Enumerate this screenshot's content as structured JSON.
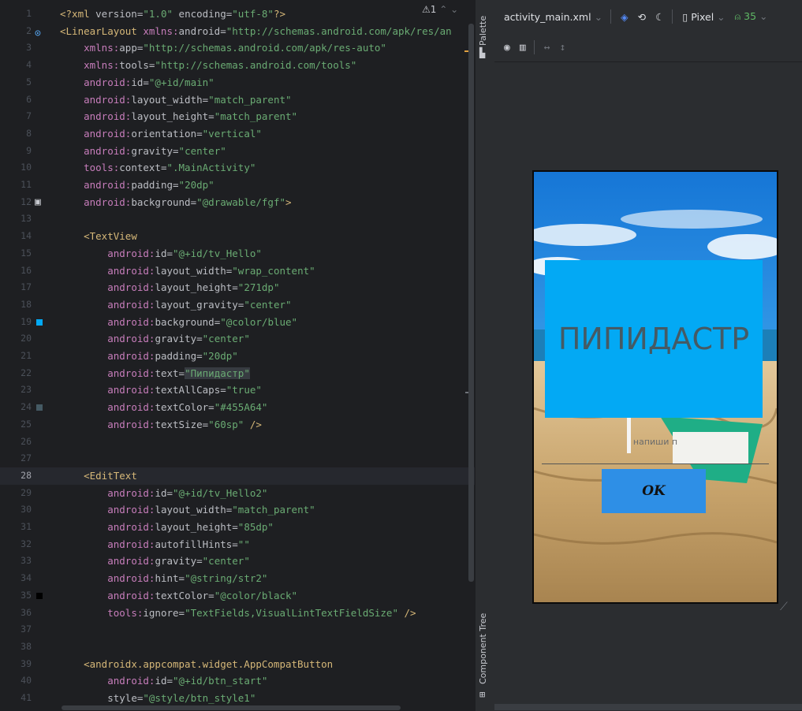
{
  "editor": {
    "warning_count": "1",
    "lines": [
      {
        "n": "1",
        "html": "<span class='t'>&lt;?xml </span><span class='a'>version=</span><span class='s'>\"1.0\"</span><span class='a'> encoding=</span><span class='s'>\"utf-8\"</span><span class='t'>?&gt;</span>"
      },
      {
        "n": "2",
        "html": "<span class='t'>&lt;LinearLayout </span><span class='ns'>xmlns:</span><span class='a'>android=</span><span class='s'>\"http://schemas.android.com/apk/res/an</span>"
      },
      {
        "n": "3",
        "html": "    <span class='ns'>xmlns:</span><span class='a'>app=</span><span class='s'>\"http://schemas.android.com/apk/res-auto\"</span>"
      },
      {
        "n": "4",
        "html": "    <span class='ns'>xmlns:</span><span class='a'>tools=</span><span class='s'>\"http://schemas.android.com/tools\"</span>"
      },
      {
        "n": "5",
        "html": "    <span class='ns'>android:</span><span class='a'>id=</span><span class='s'>\"@+id/main\"</span>"
      },
      {
        "n": "6",
        "html": "    <span class='ns'>android:</span><span class='a'>layout_width=</span><span class='s'>\"match_parent\"</span>"
      },
      {
        "n": "7",
        "html": "    <span class='ns'>android:</span><span class='a'>layout_height=</span><span class='s'>\"match_parent\"</span>"
      },
      {
        "n": "8",
        "html": "    <span class='ns'>android:</span><span class='a'>orientation=</span><span class='s'>\"vertical\"</span>"
      },
      {
        "n": "9",
        "html": "    <span class='ns'>android:</span><span class='a'>gravity=</span><span class='s'>\"center\"</span>"
      },
      {
        "n": "10",
        "html": "    <span class='ns'>tools:</span><span class='a'>context=</span><span class='s'>\".MainActivity\"</span>"
      },
      {
        "n": "11",
        "html": "    <span class='ns'>android:</span><span class='a'>padding=</span><span class='s'>\"20dp\"</span>"
      },
      {
        "n": "12",
        "html": "    <span class='ns'>android:</span><span class='a'>background=</span><span class='s'>\"@drawable/fgf\"</span><span class='t'>&gt;</span>"
      },
      {
        "n": "13",
        "html": ""
      },
      {
        "n": "14",
        "html": "    <span class='t'>&lt;TextView</span>"
      },
      {
        "n": "15",
        "html": "        <span class='ns'>android:</span><span class='a'>id=</span><span class='s'>\"@+id/tv_Hello\"</span>"
      },
      {
        "n": "16",
        "html": "        <span class='ns'>android:</span><span class='a'>layout_width=</span><span class='s'>\"wrap_content\"</span>"
      },
      {
        "n": "17",
        "html": "        <span class='ns'>android:</span><span class='a'>layout_height=</span><span class='s'>\"271dp\"</span>"
      },
      {
        "n": "18",
        "html": "        <span class='ns'>android:</span><span class='a'>layout_gravity=</span><span class='s'>\"center\"</span>"
      },
      {
        "n": "19",
        "html": "        <span class='ns'>android:</span><span class='a'>background=</span><span class='s'>\"@color/blue\"</span>"
      },
      {
        "n": "20",
        "html": "        <span class='ns'>android:</span><span class='a'>gravity=</span><span class='s'>\"center\"</span>"
      },
      {
        "n": "21",
        "html": "        <span class='ns'>android:</span><span class='a'>padding=</span><span class='s'>\"20dp\"</span>"
      },
      {
        "n": "22",
        "html": "        <span class='ns'>android:</span><span class='a'>text=</span><span class='hl'>\"Пипидастр\"</span>"
      },
      {
        "n": "23",
        "html": "        <span class='ns'>android:</span><span class='a'>textAllCaps=</span><span class='s'>\"true\"</span>"
      },
      {
        "n": "24",
        "html": "        <span class='ns'>android:</span><span class='a'>textColor=</span><span class='s'>\"#455A64\"</span>"
      },
      {
        "n": "25",
        "html": "        <span class='ns'>android:</span><span class='a'>textSize=</span><span class='s'>\"60sp\"</span><span class='t'> /&gt;</span>"
      },
      {
        "n": "26",
        "html": ""
      },
      {
        "n": "27",
        "html": ""
      },
      {
        "n": "28",
        "html": "    <span class='t'>&lt;EditText</span>"
      },
      {
        "n": "29",
        "html": "        <span class='ns'>android:</span><span class='a'>id=</span><span class='s'>\"@+id/tv_Hello2\"</span>"
      },
      {
        "n": "30",
        "html": "        <span class='ns'>android:</span><span class='a'>layout_width=</span><span class='s'>\"match_parent\"</span>"
      },
      {
        "n": "31",
        "html": "        <span class='ns'>android:</span><span class='a'>layout_height=</span><span class='s'>\"85dp\"</span>"
      },
      {
        "n": "32",
        "html": "        <span class='ns'>android:</span><span class='a'>autofillHints=</span><span class='s'>\"\"</span>"
      },
      {
        "n": "33",
        "html": "        <span class='ns'>android:</span><span class='a'>gravity=</span><span class='s'>\"center\"</span>"
      },
      {
        "n": "34",
        "html": "        <span class='ns'>android:</span><span class='a'>hint=</span><span class='s'>\"@string/str2\"</span>"
      },
      {
        "n": "35",
        "html": "        <span class='ns'>android:</span><span class='a'>textColor=</span><span class='s'>\"@color/black\"</span>"
      },
      {
        "n": "36",
        "html": "        <span class='ns'>tools:</span><span class='a'>ignore=</span><span class='s'>\"TextFields,VisualLintTextFieldSize\"</span><span class='t'> /&gt;</span>"
      },
      {
        "n": "37",
        "html": ""
      },
      {
        "n": "38",
        "html": ""
      },
      {
        "n": "39",
        "html": "    <span class='t'>&lt;androidx.appcompat.widget.AppCompatButton</span>"
      },
      {
        "n": "40",
        "html": "        <span class='ns'>android:</span><span class='a'>id=</span><span class='s'>\"@+id/btn_start\"</span>"
      },
      {
        "n": "41",
        "html": "        <span class='a'>style=</span><span class='s'>\"@style/btn_style1\"</span>"
      }
    ],
    "active_line": "28",
    "color_markers": {
      "19": "#03a9f4",
      "24": "#455a64",
      "35": "#000000"
    }
  },
  "side_strip": {
    "palette_label": "Palette",
    "component_tree_label": "Component Tree"
  },
  "design_toolbar": {
    "file_name": "activity_main.xml",
    "device": "Pixel",
    "api_level": "35"
  },
  "preview": {
    "text_view": "ПИПИДАСТР",
    "edit_hint": "напиши п",
    "button_label": "OK",
    "colors": {
      "text_view_bg": "#03a9f4",
      "text_color": "#455a64",
      "button_bg": "#2e8fe6"
    }
  }
}
